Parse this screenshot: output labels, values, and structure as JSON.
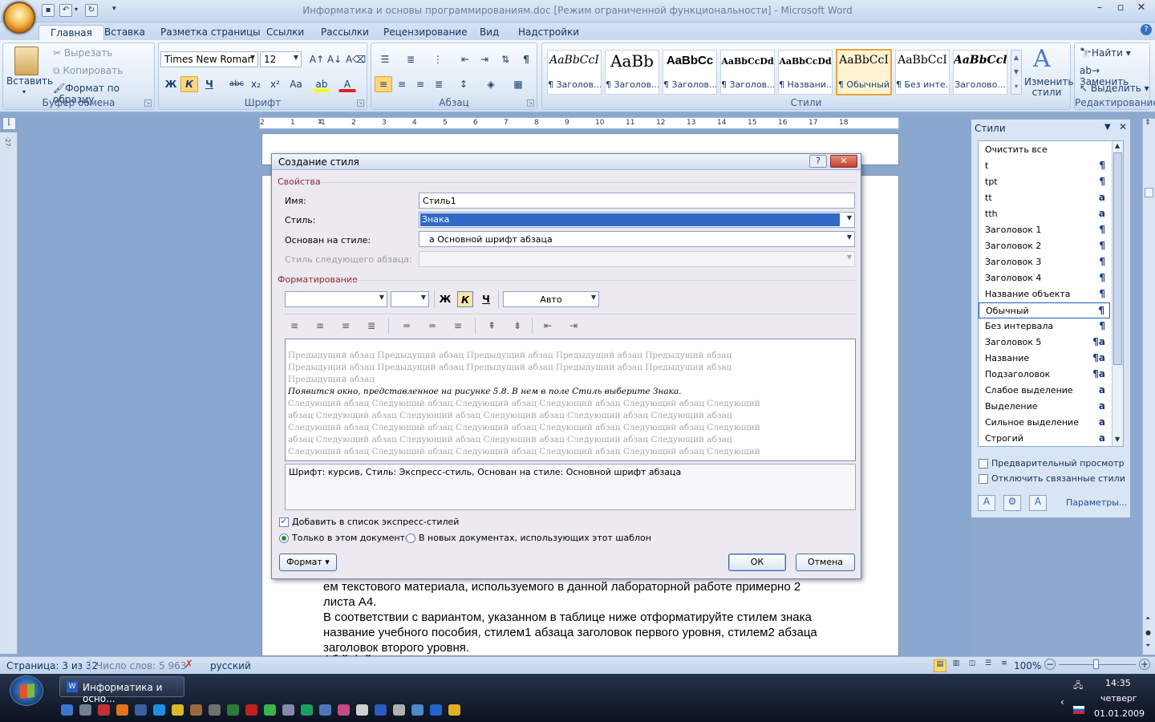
{
  "window": {
    "title": "Информатика и основы программированиям.doc [Режим ограниченной функциональности] - Microsoft Word"
  },
  "tabs": [
    "Главная",
    "Вставка",
    "Разметка страницы",
    "Ссылки",
    "Рассылки",
    "Рецензирование",
    "Вид",
    "Надстройки"
  ],
  "ribbon": {
    "clipboard": {
      "label": "Буфер обмена",
      "paste": "Вставить",
      "cut": "Вырезать",
      "copy": "Копировать",
      "format_painter": "Формат по образцу"
    },
    "font": {
      "label": "Шрифт",
      "name": "Times New Roman",
      "size": "12",
      "bold": "Ж",
      "italic": "К",
      "underline": "Ч",
      "strike": "abc",
      "sub": "x₂",
      "sup": "x²",
      "case": "Aa"
    },
    "paragraph": {
      "label": "Абзац"
    },
    "styles": {
      "label": "Стили",
      "items": [
        {
          "preview": "AaBbCcI",
          "name": "¶ Заголов..."
        },
        {
          "preview": "AaBb",
          "name": "¶ Заголов..."
        },
        {
          "preview": "AaBbCc",
          "name": "¶ Заголов..."
        },
        {
          "preview": "AaBbCcDd",
          "name": "¶ Заголов..."
        },
        {
          "preview": "AaBbCcDd",
          "name": "¶ Названи..."
        },
        {
          "preview": "AaBbCcI",
          "name": "¶ Обычный"
        },
        {
          "preview": "AaBbCcI",
          "name": "¶ Без инте..."
        },
        {
          "preview": "AaBbCcl",
          "name": "Заголово..."
        }
      ],
      "change": "Изменить стили"
    },
    "editing": {
      "label": "Редактирование",
      "find": "Найти",
      "replace": "Заменить",
      "select": "Выделить"
    }
  },
  "ruler": {
    "ticks": [
      "2",
      "1",
      "1",
      "2",
      "3",
      "4",
      "5",
      "6",
      "7",
      "8",
      "9",
      "10",
      "11",
      "12",
      "13",
      "14",
      "15",
      "16",
      "17",
      "18"
    ]
  },
  "document": {
    "lines": [
      "ем текстового материала, используемого в данной лабораторной работе примерно 2",
      "листа А4.",
      "В соответствии с вариантом, указанном в таблице ниже отформатируйте стилем знака",
      "название учебного пособия, стилем1 абзаца заголовок первого уровня, стилем2 абзаца",
      "заголовок второго уровня.",
      "Аб                                   й           ф            й"
    ]
  },
  "dialog": {
    "title": "Создание стиля",
    "properties_label": "Свойства",
    "name_label": "Имя:",
    "name_value": "Стиль1",
    "type_label": "Стиль:",
    "type_value": "Знака",
    "based_label": "Основан на стиле:",
    "based_value": "a  Основной шрифт абзаца",
    "next_label": "Стиль следующего абзаца:",
    "formatting_label": "Форматирование",
    "color_value": "Авто",
    "bold": "Ж",
    "italic": "К",
    "underline": "Ч",
    "preview_prev": [
      "Предыдущий абзац Предыдущий абзац Предыдущий абзац Предыдущий абзац Предыдущий абзац",
      "Предыдущий абзац Предыдущий абзац Предыдущий абзац Предыдущий абзац Предыдущий абзац",
      "Предыдущий абзац"
    ],
    "preview_main": "Появится окно, представленное на рисунке 5.8. В нем в поле  Стиль выберите Знака.",
    "preview_next": [
      "Следующий абзац Следующий абзац Следующий абзац Следующий абзац Следующий абзац Следующий",
      "абзац Следующий абзац Следующий абзац Следующий абзац Следующий абзац Следующий абзац",
      "Следующий абзац Следующий абзац Следующий абзац Следующий абзац Следующий абзац Следующий",
      "абзац Следующий абзац Следующий абзац Следующий абзац Следующий абзац Следующий абзац",
      "Следующий абзац Следующий абзац Следующий абзац Следующий абзац Следующий абзац Следующий"
    ],
    "description": "Шрифт: курсив, Стиль: Экспресс-стиль, Основан на стиле: Основной шрифт абзаца",
    "add_quick": "Добавить в список экспресс-стилей",
    "only_doc": "Только в этом документе",
    "new_docs": "В новых документах, использующих этот шаблон",
    "format_btn": "Формат ▾",
    "ok": "ОК",
    "cancel": "Отмена"
  },
  "styles_pane": {
    "title": "Стили",
    "items": [
      {
        "name": "Очистить все",
        "mark": ""
      },
      {
        "name": "t",
        "mark": "¶"
      },
      {
        "name": "tpt",
        "mark": "¶"
      },
      {
        "name": "tt",
        "mark": "a"
      },
      {
        "name": "tth",
        "mark": "a"
      },
      {
        "name": "Заголовок 1",
        "mark": "¶"
      },
      {
        "name": "Заголовок 2",
        "mark": "¶"
      },
      {
        "name": "Заголовок 3",
        "mark": "¶"
      },
      {
        "name": "Заголовок 4",
        "mark": "¶"
      },
      {
        "name": "Название объекта",
        "mark": "¶"
      },
      {
        "name": "Обычный",
        "mark": "¶"
      },
      {
        "name": "Без интервала",
        "mark": "¶"
      },
      {
        "name": "Заголовок 5",
        "mark": "¶a"
      },
      {
        "name": "Название",
        "mark": "¶a"
      },
      {
        "name": "Подзаголовок",
        "mark": "¶a"
      },
      {
        "name": "Слабое выделение",
        "mark": "a"
      },
      {
        "name": "Выделение",
        "mark": "a"
      },
      {
        "name": "Сильное выделение",
        "mark": "a"
      },
      {
        "name": "Строгий",
        "mark": "a"
      }
    ],
    "preview_label": "Предварительный просмотр",
    "disable_linked": "Отключить связанные стили",
    "options": "Параметры..."
  },
  "status": {
    "page": "Страница: 3 из 32",
    "words": "Число слов: 5 963",
    "lang": "русский",
    "zoom": "100%"
  },
  "taskbar": {
    "task": "Информатика и осно...",
    "time": "14:35",
    "day": "четверг",
    "date": "01.01.2009"
  }
}
